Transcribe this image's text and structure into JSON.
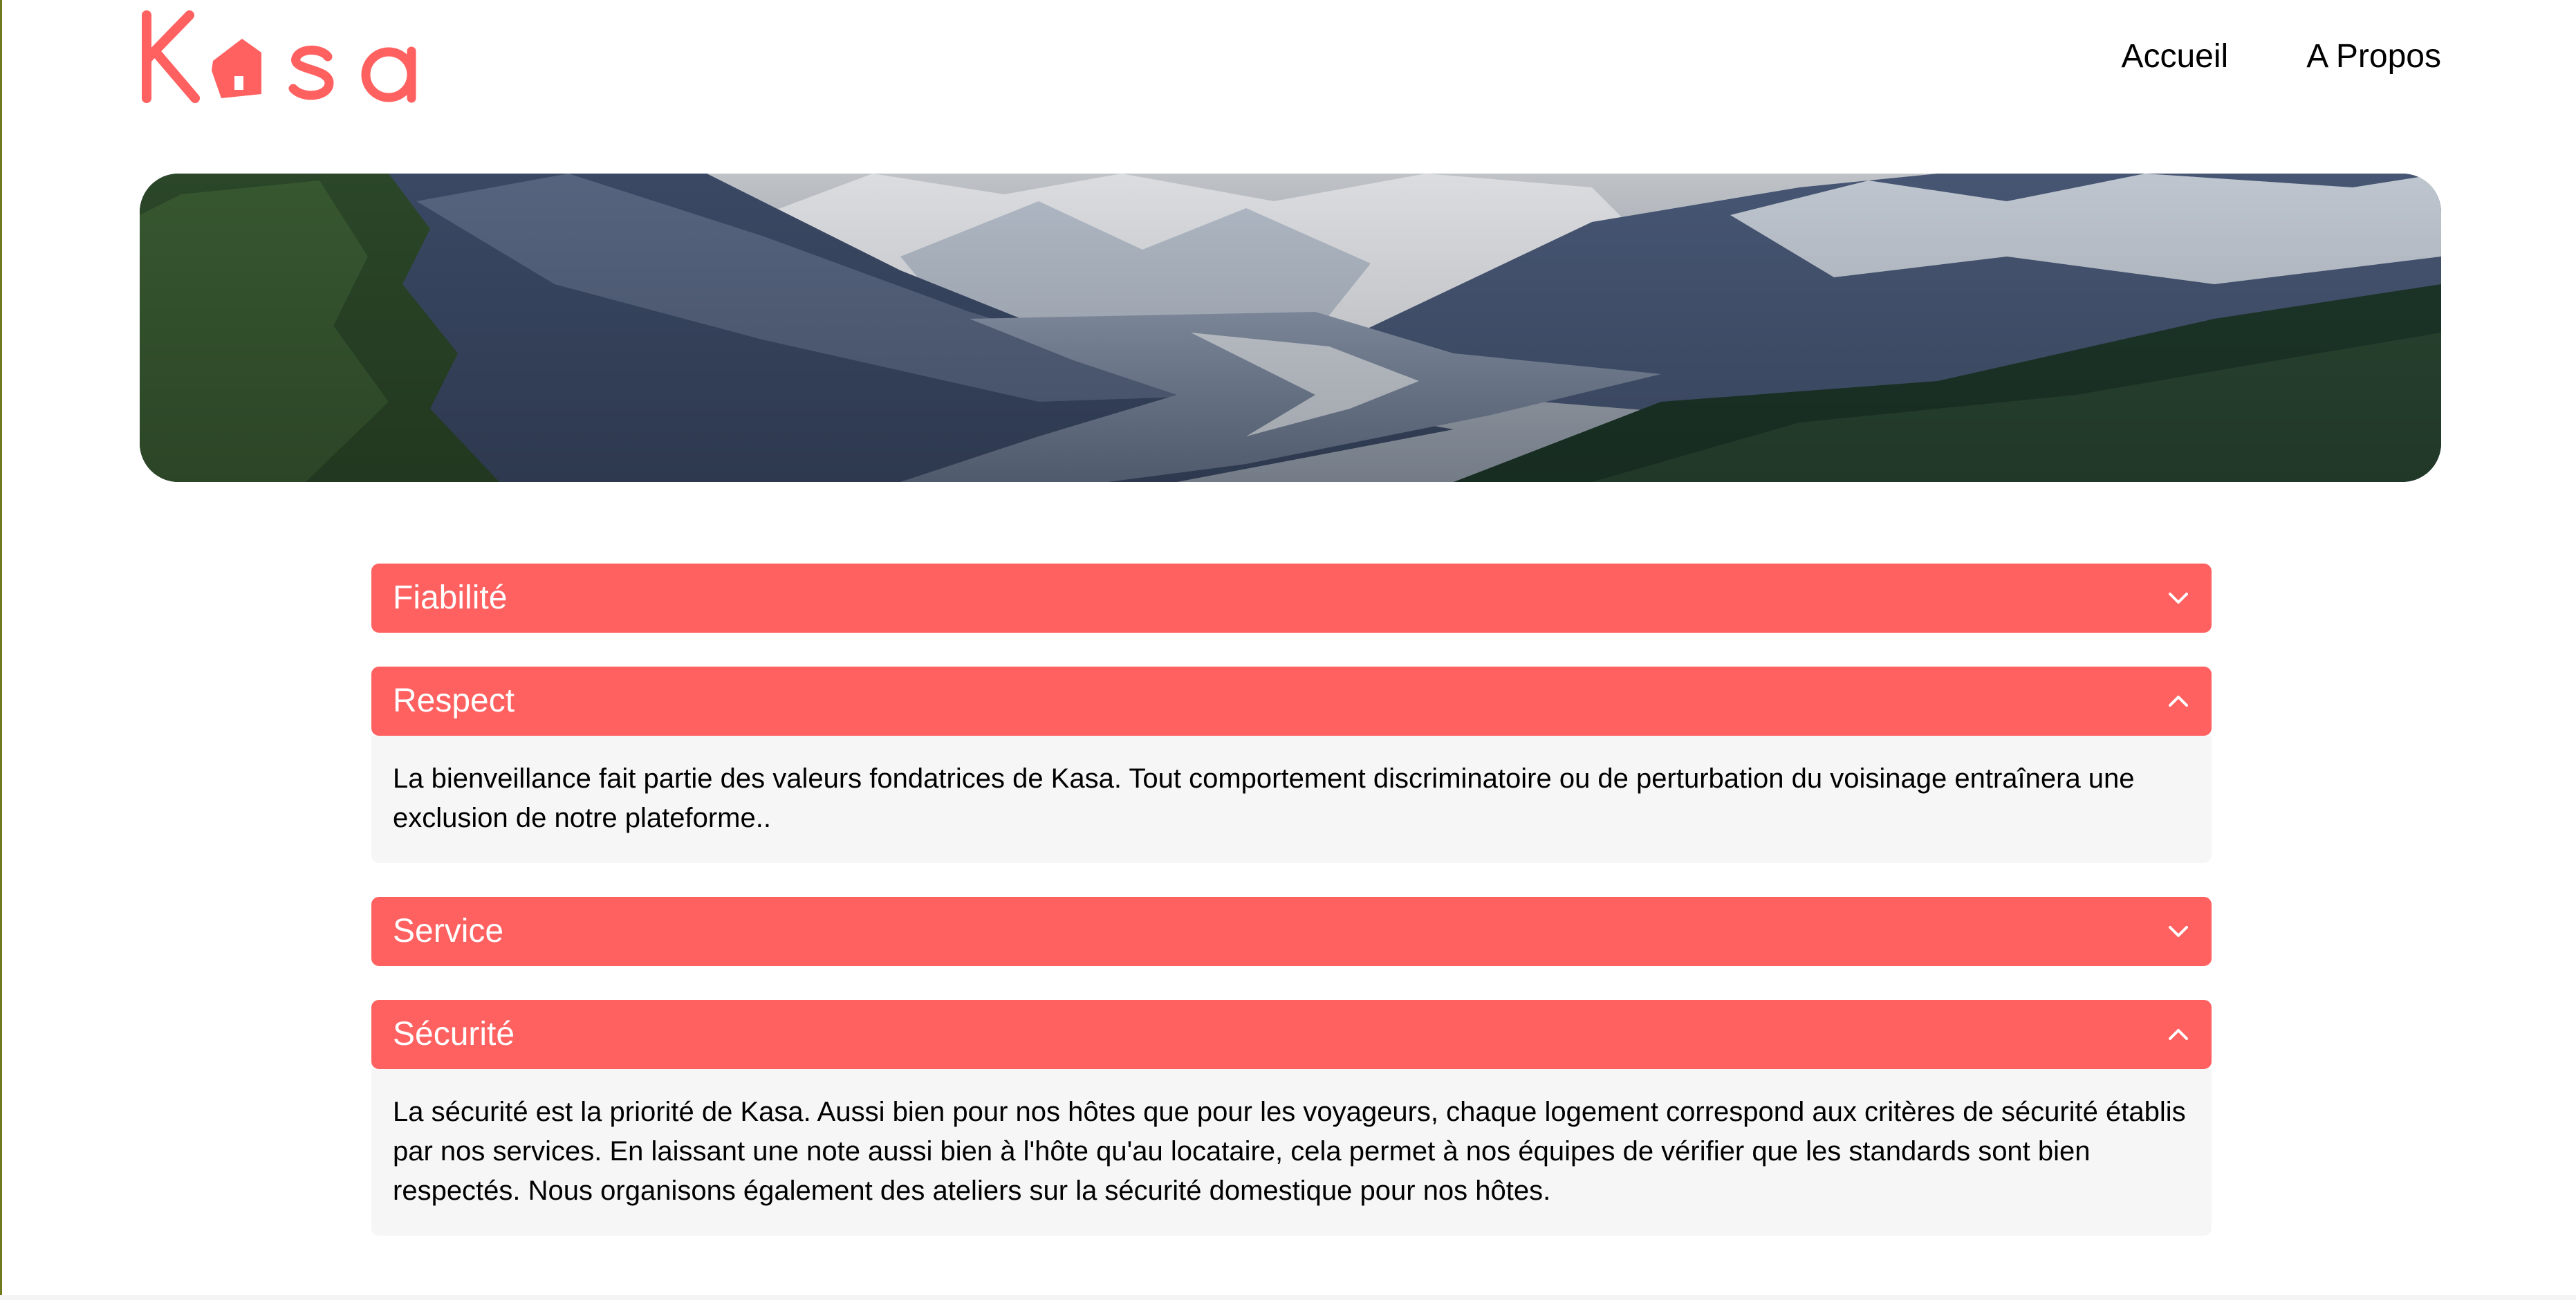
{
  "brand": {
    "name": "Kasa",
    "color": "#ff6060"
  },
  "nav": {
    "items": [
      {
        "label": "Accueil"
      },
      {
        "label": "A Propos"
      }
    ]
  },
  "banner": {
    "image": "mountain-landscape"
  },
  "accordion": {
    "items": [
      {
        "title": "Fiabilité",
        "expanded": false,
        "icon": "chevron-down-icon",
        "content": ""
      },
      {
        "title": "Respect",
        "expanded": true,
        "icon": "chevron-up-icon",
        "content": "La bienveillance fait partie des valeurs fondatrices de Kasa. Tout comportement discriminatoire ou de perturbation du voisinage entraînera une exclusion de notre plateforme.."
      },
      {
        "title": "Service",
        "expanded": false,
        "icon": "chevron-down-icon",
        "content": ""
      },
      {
        "title": "Sécurité",
        "expanded": true,
        "icon": "chevron-up-icon",
        "content": "La sécurité est la priorité de Kasa. Aussi bien pour nos hôtes que pour les voyageurs, chaque logement correspond aux critères de sécurité établis par nos services. En laissant une note aussi bien à l'hôte qu'au locataire, cela permet à nos équipes de vérifier que les standards sont bien respectés. Nous organisons également des ateliers sur la sécurité domestique pour nos hôtes."
      }
    ]
  }
}
